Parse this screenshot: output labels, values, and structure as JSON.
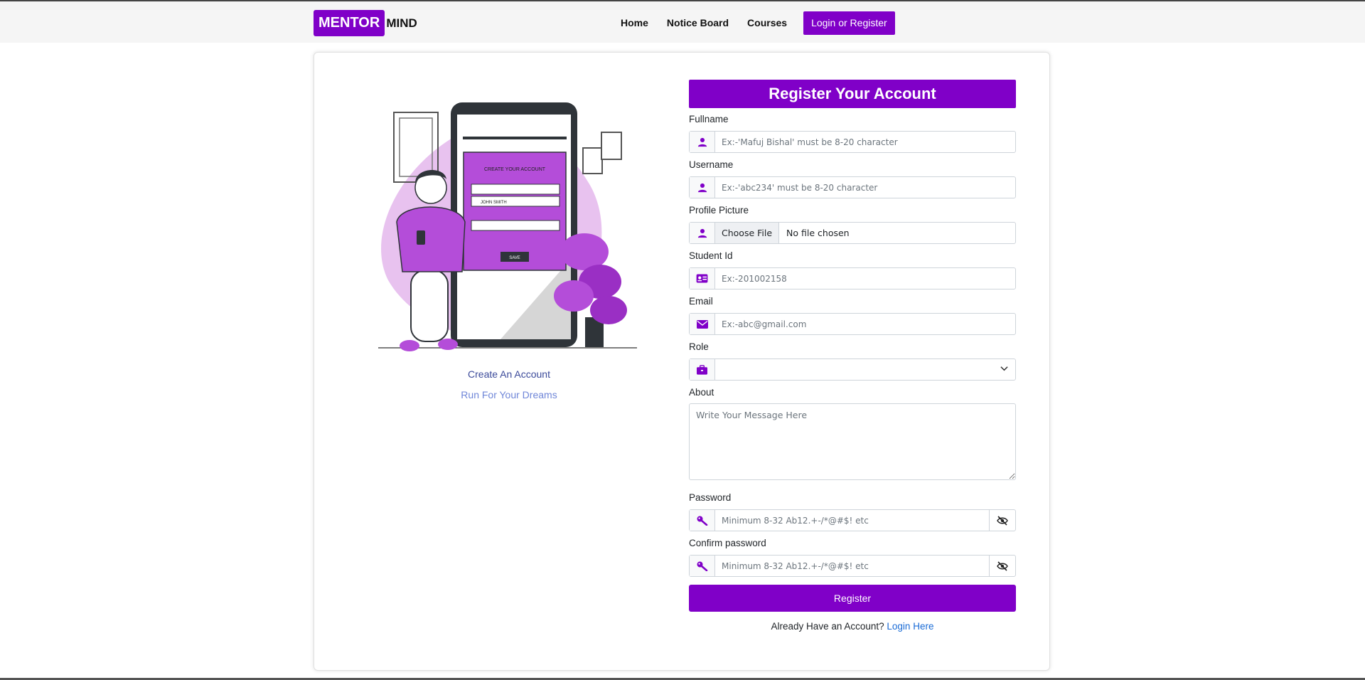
{
  "navbar": {
    "brand_box": "MENTOR",
    "brand_rest": "MIND",
    "links": [
      "Home",
      "Notice Board",
      "Courses"
    ],
    "login_button": "Login or Register"
  },
  "illustration": {
    "phone_heading": "CREATE YOUR ACCOUNT",
    "phone_field": "JOHN SMITH",
    "phone_button": "SAVE",
    "caption_title": "Create An Account",
    "caption_subtitle": "Run For Your Dreams"
  },
  "form": {
    "title": "Register Your Account",
    "fullname": {
      "label": "Fullname",
      "placeholder": "Ex:-'Mafuj Bishal' must be 8-20 character"
    },
    "username": {
      "label": "Username",
      "placeholder": "Ex:-'abc234' must be 8-20 character"
    },
    "profile_picture": {
      "label": "Profile Picture",
      "button": "Choose File",
      "status": "No file chosen"
    },
    "student_id": {
      "label": "Student Id",
      "placeholder": "Ex:-201002158"
    },
    "email": {
      "label": "Email",
      "placeholder": "Ex:-abc@gmail.com"
    },
    "role": {
      "label": "Role",
      "value": ""
    },
    "about": {
      "label": "About",
      "placeholder": "Write Your Message Here"
    },
    "password": {
      "label": "Password",
      "placeholder": "Minimum 8-32 Ab12.+-/*@#$! etc"
    },
    "confirm_password": {
      "label": "Confirm password",
      "placeholder": "Minimum 8-32 Ab12.+-/*@#$! etc"
    },
    "register_button": "Register",
    "already_text": "Already Have an Account?",
    "login_link": "Login Here"
  },
  "colors": {
    "accent": "#8000c8",
    "link": "#1a6bd6",
    "caption_title": "#3b4a9a",
    "caption_subtitle": "#6f86d8"
  },
  "icons": {
    "fullname": "user-icon",
    "username": "user-icon",
    "profile_picture": "user-icon",
    "student_id": "id-card-icon",
    "email": "envelope-icon",
    "role": "briefcase-icon",
    "password": "key-icon",
    "confirm_password": "key-icon",
    "toggle": "eye-slash-icon"
  }
}
